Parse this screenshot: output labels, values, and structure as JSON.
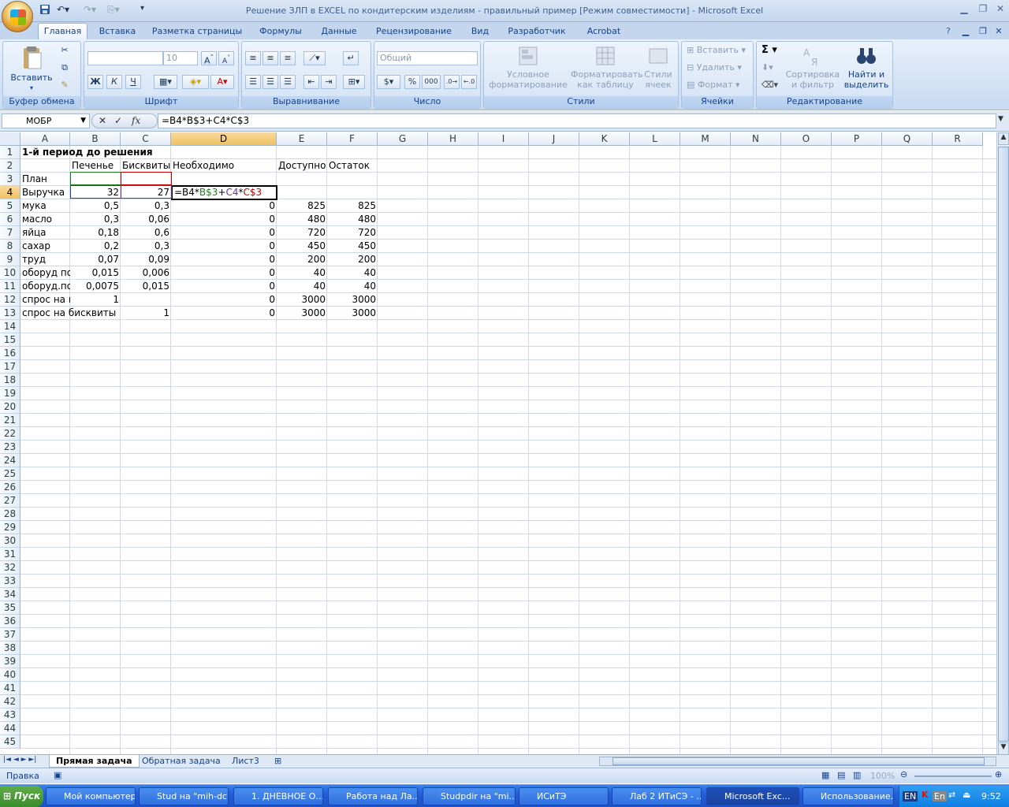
{
  "window": {
    "title": "Решение ЗЛП в EXCEL по кондитерским изделиям - правильный пример  [Режим совместимости] - Microsoft Excel"
  },
  "qat_icons": [
    "save-icon",
    "undo-icon",
    "redo-icon",
    "paste-format-icon",
    "customize-icon"
  ],
  "tabs": [
    "Главная",
    "Вставка",
    "Разметка страницы",
    "Формулы",
    "Данные",
    "Рецензирование",
    "Вид",
    "Разработчик",
    "Acrobat"
  ],
  "ribbon": {
    "clipboard": {
      "label": "Буфер обмена",
      "paste": "Вставить"
    },
    "font": {
      "label": "Шрифт",
      "size": "10",
      "bold": "Ж",
      "italic": "К",
      "underline": "Ч"
    },
    "alignment": {
      "label": "Выравнивание"
    },
    "number": {
      "label": "Число",
      "format": "Общий",
      "percent": "%",
      "thousands": "000"
    },
    "styles": {
      "label": "Стили",
      "cond1": "Условное",
      "cond2": "форматирование",
      "table1": "Форматировать",
      "table2": "как таблицу",
      "cell1": "Стили",
      "cell2": "ячеек"
    },
    "cells": {
      "label": "Ячейки",
      "insert": "Вставить",
      "delete": "Удалить",
      "format": "Формат"
    },
    "editing": {
      "label": "Редактирование",
      "sort1": "Сортировка",
      "sort2": "и фильтр",
      "find1": "Найти и",
      "find2": "выделить"
    }
  },
  "formula_bar": {
    "name_box": "МОБР",
    "fx": "fx",
    "formula": "=B4*B$3+C4*C$3"
  },
  "columns": [
    "A",
    "B",
    "C",
    "D",
    "E",
    "F",
    "G",
    "H",
    "I",
    "J",
    "K",
    "L",
    "M",
    "N",
    "O",
    "P",
    "Q",
    "R"
  ],
  "rows": [
    "1",
    "2",
    "3",
    "4",
    "5",
    "6",
    "7",
    "8",
    "9",
    "10",
    "11",
    "12",
    "13",
    "14",
    "15",
    "16",
    "17",
    "18",
    "19",
    "20",
    "21",
    "22",
    "23",
    "24",
    "25",
    "26",
    "27",
    "28",
    "29",
    "30",
    "31",
    "32",
    "33",
    "34",
    "35",
    "36",
    "37",
    "38",
    "39",
    "40",
    "41",
    "42",
    "43",
    "44",
    "45"
  ],
  "cells": {
    "A1": "1-й период до решения",
    "B2": "Печенье",
    "C2": "Бисквиты",
    "D2": "Необходимо",
    "E2": "Доступно",
    "F2": "Остаток",
    "A3": "План",
    "A4": "Выручка",
    "B4": "32",
    "C4": "27",
    "D4_parts": [
      "=B4*",
      "B$3",
      "+",
      "C4",
      "*",
      "C$3"
    ],
    "A5": "мука",
    "B5": "0,5",
    "C5": "0,3",
    "D5": "0",
    "E5": "825",
    "F5": "825",
    "A6": "масло",
    "B6": "0,3",
    "C6": "0,06",
    "D6": "0",
    "E6": "480",
    "F6": "480",
    "A7": "яйца",
    "B7": "0,18",
    "C7": "0,6",
    "D7": "0",
    "E7": "720",
    "F7": "720",
    "A8": "сахар",
    "B8": "0,2",
    "C8": "0,3",
    "D8": "0",
    "E8": "450",
    "F8": "450",
    "A9": "труд",
    "B9": "0,07",
    "C9": "0,09",
    "D9": "0",
    "E9": "200",
    "F9": "200",
    "A10": "оборуд по",
    "B10": "0,015",
    "C10": "0,006",
    "D10": "0",
    "E10": "40",
    "F10": "40",
    "A11": "оборуд.по",
    "B11": "0,0075",
    "C11": "0,015",
    "D11": "0",
    "E11": "40",
    "F11": "40",
    "A12": "спрос на г",
    "B12": "1",
    "D12": "0",
    "E12": "3000",
    "F12": "3000",
    "A13": "спрос на бисквиты",
    "C13": "1",
    "D13": "0",
    "E13": "3000",
    "F13": "3000"
  },
  "sheets": [
    "Прямая задача",
    "Обратная задача",
    "Лист3"
  ],
  "status": {
    "mode": "Правка",
    "zoom": "100%"
  },
  "taskbar": {
    "start": "Пуск",
    "items": [
      "Мой компьютер",
      "Stud на \"mih-dc...",
      "1. ДНЕВНОЕ О...",
      "Работа над Ла...",
      "Studpdir на \"mi...",
      "ИСиТЭ",
      "Лаб 2 ИТиСЭ - ...",
      "Microsoft Exc...",
      "Использование..."
    ],
    "lang": "EN",
    "lang2": "En",
    "time": "9:52"
  }
}
